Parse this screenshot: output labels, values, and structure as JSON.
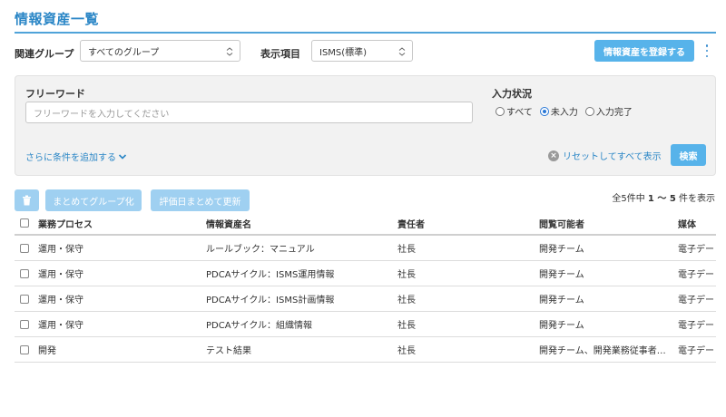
{
  "page": {
    "title": "情報資産一覧"
  },
  "toolbar": {
    "group_label": "関連グループ",
    "group_value": "すべてのグループ",
    "display_label": "表示項目",
    "display_value": "ISMS(標準)",
    "register_label": "情報資産を登録する"
  },
  "filter": {
    "keyword_label": "フリーワード",
    "keyword_placeholder": "フリーワードを入力してください",
    "status_label": "入力状況",
    "status_options": [
      "すべて",
      "未入力",
      "入力完了"
    ],
    "status_selected": "未入力",
    "add_condition_label": "さらに条件を追加する",
    "reset_label": "リセットしてすべて表示",
    "search_label": "検索"
  },
  "actions": {
    "group_bulk_label": "まとめてグループ化",
    "update_bulk_label": "評価日まとめて更新"
  },
  "count": {
    "prefix": "全5件中",
    "range": "1 〜 5",
    "suffix": "件を表示"
  },
  "table": {
    "headers": [
      "業務プロセス",
      "情報資産名",
      "責任者",
      "閲覧可能者",
      "媒体"
    ],
    "rows": [
      [
        "運用・保守",
        "ルールブック：マニュアル",
        "社長",
        "開発チーム",
        "電子デー"
      ],
      [
        "運用・保守",
        "PDCAサイクル：ISMS運用情報",
        "社長",
        "開発チーム",
        "電子デー"
      ],
      [
        "運用・保守",
        "PDCAサイクル：ISMS計画情報",
        "社長",
        "開発チーム",
        "電子デー"
      ],
      [
        "運用・保守",
        "PDCAサイクル：組織情報",
        "社長",
        "開発チーム",
        "電子デー"
      ],
      [
        "開発",
        "テスト結果",
        "社長",
        "開発チーム、開発業務従事者…",
        "電子デー"
      ]
    ]
  },
  "colors": {
    "accent": "#2a86c6",
    "button": "#57b3ea",
    "button_disabled": "#9fd0f1"
  }
}
